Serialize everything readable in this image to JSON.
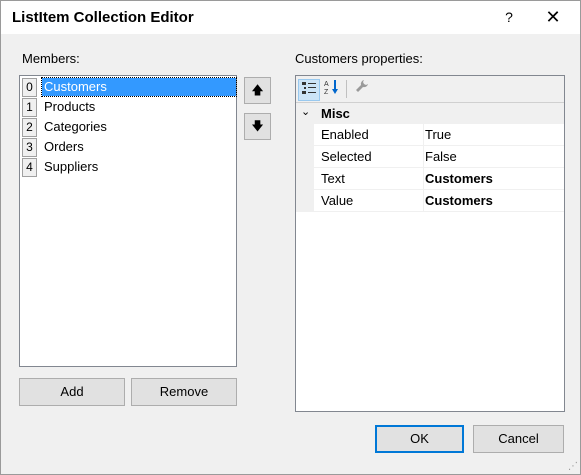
{
  "window": {
    "title": "ListItem Collection Editor",
    "help": "?",
    "close": "✕"
  },
  "members": {
    "label": "Members:",
    "items": [
      {
        "index": "0",
        "text": "Customers"
      },
      {
        "index": "1",
        "text": "Products"
      },
      {
        "index": "2",
        "text": "Categories"
      },
      {
        "index": "3",
        "text": "Orders"
      },
      {
        "index": "4",
        "text": "Suppliers"
      }
    ],
    "selected_index": 0,
    "move_up": "🡅",
    "move_down": "🡇",
    "add": "Add",
    "remove": "Remove"
  },
  "properties": {
    "label": "Customers properties:",
    "toolbar": {
      "categorized_icon": "categorized-icon",
      "alphabetical_icon": "alphabetical-icon",
      "property_pages_icon": "wrench-icon"
    },
    "category": {
      "name": "Misc",
      "toggle": "⌄"
    },
    "rows": [
      {
        "name": "Enabled",
        "value": "True",
        "bold": false
      },
      {
        "name": "Selected",
        "value": "False",
        "bold": false
      },
      {
        "name": "Text",
        "value": "Customers",
        "bold": true
      },
      {
        "name": "Value",
        "value": "Customers",
        "bold": true
      }
    ]
  },
  "footer": {
    "ok": "OK",
    "cancel": "Cancel"
  },
  "colors": {
    "selection": "#3399ff",
    "accent": "#0078d7"
  }
}
